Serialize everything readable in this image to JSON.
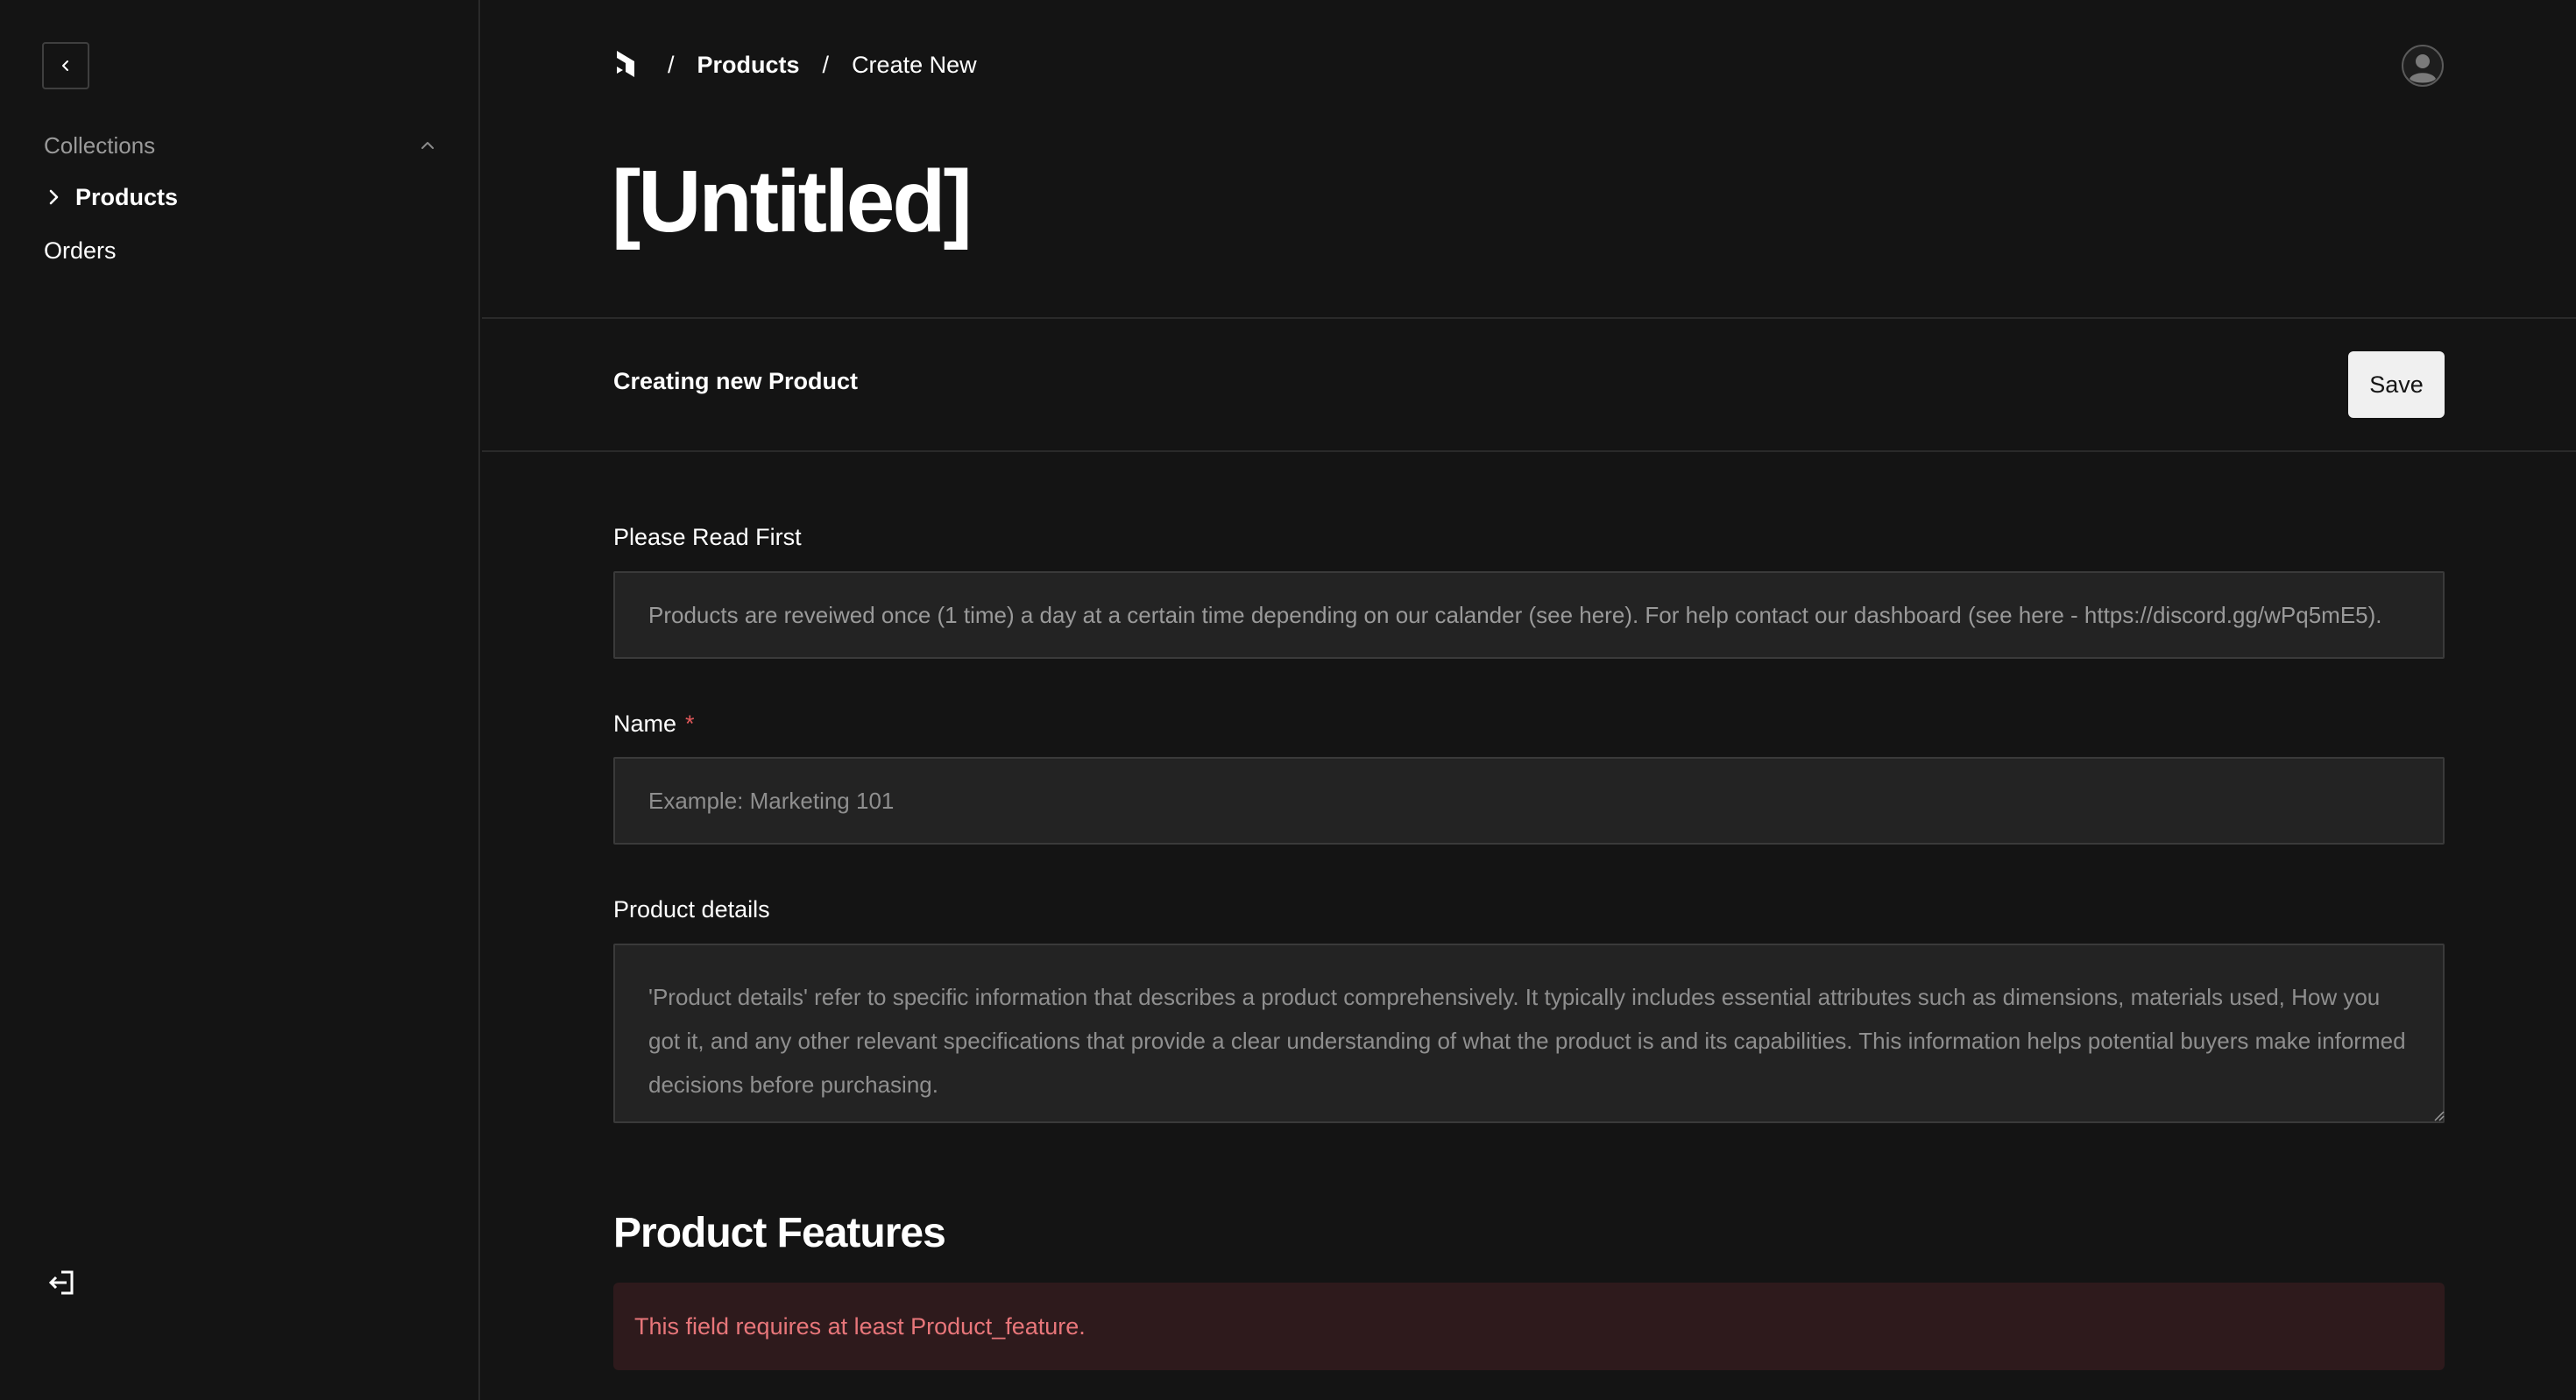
{
  "sidebar": {
    "collapse_icon": "chevron-left-icon",
    "collections_label": "Collections",
    "collections_toggle_icon": "chevron-up-icon",
    "items": [
      {
        "label": "Products",
        "active": true,
        "icon": "chevron-right-icon"
      },
      {
        "label": "Orders",
        "active": false
      }
    ],
    "logout_icon": "logout-icon"
  },
  "header": {
    "logo_icon": "payload-logo-icon",
    "breadcrumb": {
      "separator": "/",
      "products": "Products",
      "current": "Create New"
    },
    "avatar_icon": "user-avatar-icon"
  },
  "page": {
    "title": "[Untitled]",
    "status": "Creating new Product",
    "save_label": "Save"
  },
  "form": {
    "read_first": {
      "label": "Please Read First",
      "value": "Products are reveiwed once (1 time) a day at a certain time depending on our calander (see here). For help contact our dashboard (see here - https://discord.gg/wPq5mE5)."
    },
    "name": {
      "label": "Name",
      "required_marker": "*",
      "placeholder": "Example: Marketing 101",
      "value": ""
    },
    "product_details": {
      "label": "Product details",
      "placeholder": "'Product details' refer to specific information that describes a product comprehensively. It typically includes essential attributes such as dimensions, materials used, How you got it, and any other relevant specifications that provide a clear understanding of what the product is and its capabilities. This information helps potential buyers make informed decisions before purchasing.",
      "value": ""
    }
  },
  "features": {
    "title": "Product Features",
    "error": "This field requires at least Product_feature."
  },
  "colors": {
    "background": "#141414",
    "field_bg": "#232323",
    "error_bg": "#2e1a1c",
    "error_text": "#e8767a",
    "required": "#e0585a",
    "button_bg": "#f0f0f0"
  }
}
